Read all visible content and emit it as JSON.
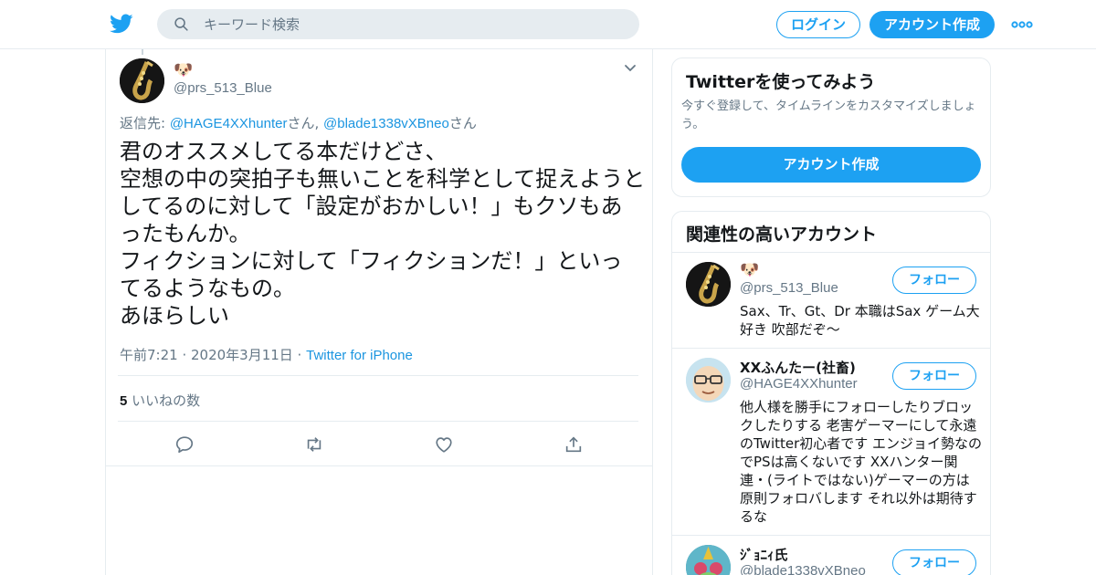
{
  "header": {
    "search_placeholder": "キーワード検索",
    "login_label": "ログイン",
    "signup_label": "アカウント作成",
    "accent_color": "#1da1f2"
  },
  "tweet": {
    "author_name": "🐶",
    "author_handle": "@prs_513_Blue",
    "replying_prefix": "返信先: ",
    "replying_to": [
      {
        "handle": "@HAGE4XXhunter",
        "suffix": "さん, "
      },
      {
        "handle": "@blade1338vXBneo",
        "suffix": "さん"
      }
    ],
    "text_lines": [
      "君のオススメしてる本だけどさ、",
      "空想の中の突拍子も無いことを科学として捉えようと",
      "してるのに対して「設定がおかしい！」もクソもあ",
      "ったもんか。",
      "フィクションに対して「フィクションだ！」といっ",
      "てるようなもの。",
      "あほらしい"
    ],
    "timestamp": "午前7:21 · 2020年3月11日 · ",
    "source": "Twitter for iPhone",
    "like_count": "5",
    "like_label": " いいねの数",
    "actions": [
      "reply-icon",
      "retweet-icon",
      "like-icon",
      "share-icon"
    ]
  },
  "sidebar": {
    "signup_card": {
      "title": "Twitterを使ってみよう",
      "description_lines": [
        "今すぐ登録して、タイムラインをカスタマイズしましょ",
        "う。"
      ],
      "button_label": "アカウント作成"
    },
    "related": {
      "title": "関連性の高いアカウント",
      "follow_label": "フォロー",
      "accounts": [
        {
          "name": "🐶",
          "handle": "@prs_513_Blue",
          "bio_lines": [
            "Sax、Tr、Gt、Dr 本職はSax ゲーム大",
            "好き 吹部だぞ〜"
          ]
        },
        {
          "name": "XXふんたー(社畜)",
          "handle": "@HAGE4XXhunter",
          "bio_lines": [
            "他人様を勝手にフォローしたりブロッ",
            "クしたりする 老害ゲーマーにして永遠",
            "のTwitter初心者です エンジョイ勢なの",
            "でPSは高くないです XXハンター関",
            "連・(ライトではない)ゲーマーの方は",
            "原則フォロバします それ以外は期待す",
            "るな"
          ]
        },
        {
          "name": "ｼﾞｮﾆｨ氏",
          "handle": "@blade1338vXBneo",
          "bio_lines": []
        }
      ]
    }
  }
}
